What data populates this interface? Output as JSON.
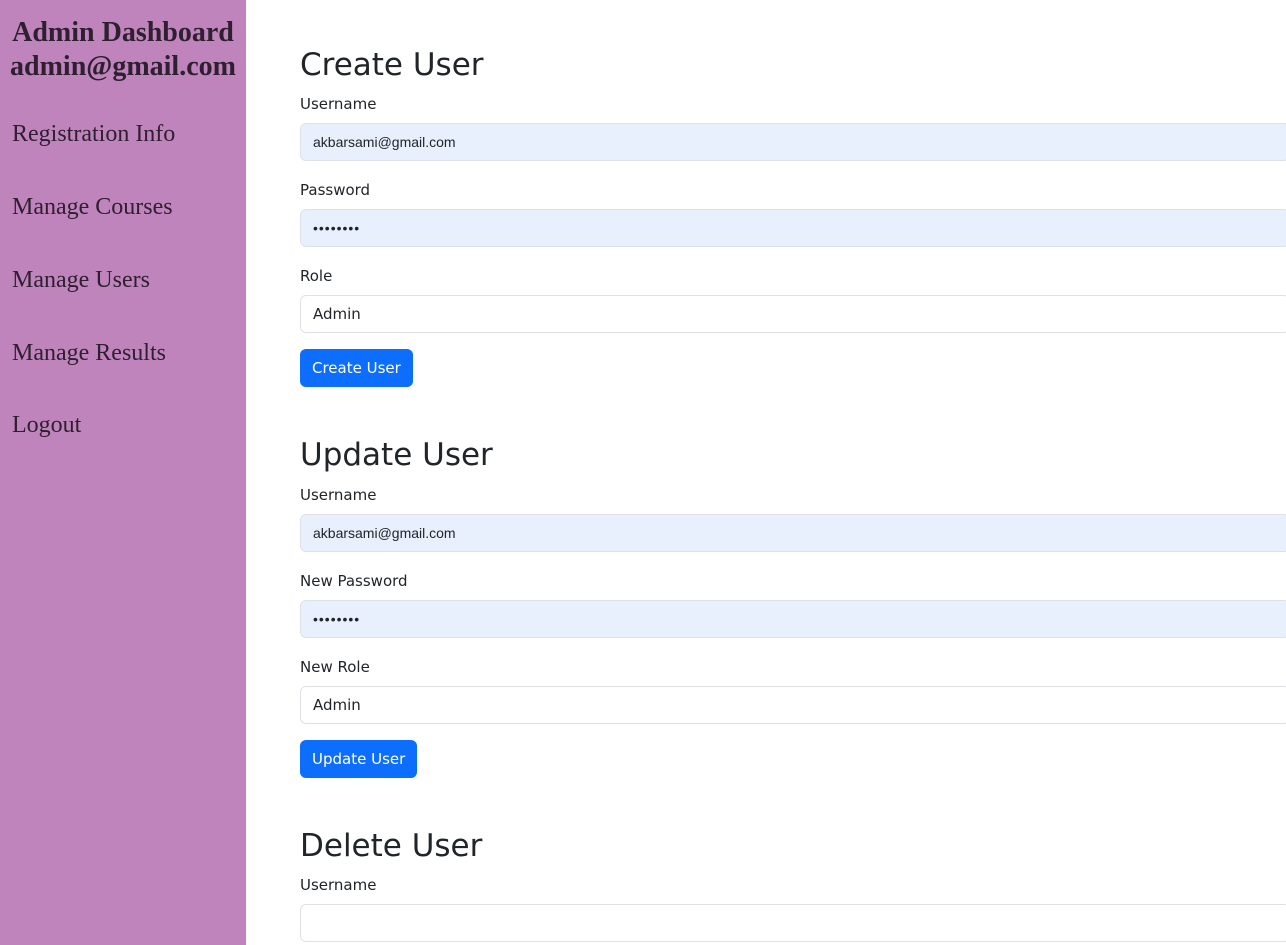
{
  "sidebar": {
    "title": "Admin Dashboard",
    "email": "admin@gmail.com",
    "items": [
      {
        "label": "Registration Info"
      },
      {
        "label": "Manage Courses"
      },
      {
        "label": "Manage Users"
      },
      {
        "label": "Manage Results"
      },
      {
        "label": "Logout"
      }
    ]
  },
  "create": {
    "title": "Create User",
    "username_label": "Username",
    "username_value": "akbarsami@gmail.com",
    "password_label": "Password",
    "password_value": "••••••••",
    "role_label": "Role",
    "role_value": "Admin",
    "button": "Create User"
  },
  "update": {
    "title": "Update User",
    "username_label": "Username",
    "username_value": "akbarsami@gmail.com",
    "password_label": "New Password",
    "password_value": "••••••••",
    "role_label": "New Role",
    "role_value": "Admin",
    "button": "Update User"
  },
  "delete": {
    "title": "Delete User",
    "username_label": "Username",
    "username_value": ""
  },
  "colors": {
    "sidebar_bg": "#c084bd",
    "primary_button": "#0d6efd",
    "autofill_bg": "#e8f0fe"
  }
}
